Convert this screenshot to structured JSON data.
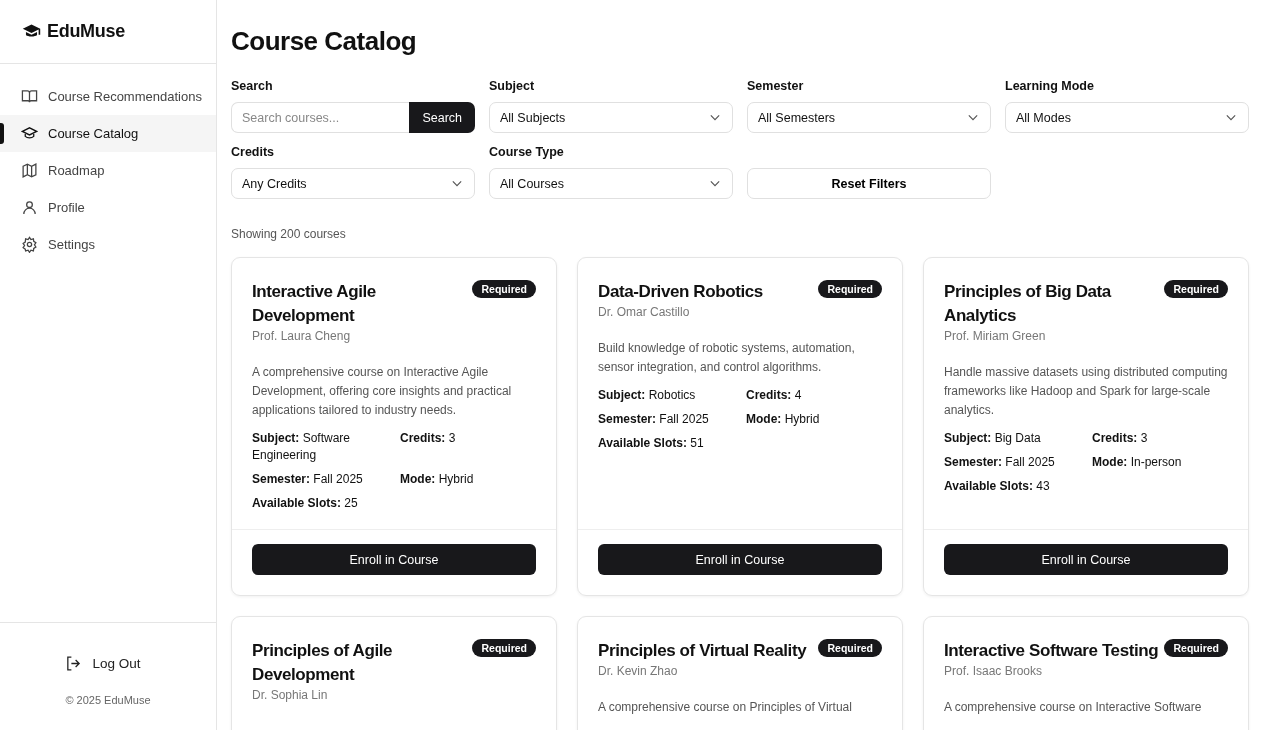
{
  "brand": {
    "name": "EduMuse"
  },
  "nav": [
    {
      "label": "Course Recommendations",
      "selected": false
    },
    {
      "label": "Course Catalog",
      "selected": true
    },
    {
      "label": "Roadmap",
      "selected": false
    },
    {
      "label": "Profile",
      "selected": false
    },
    {
      "label": "Settings",
      "selected": false
    }
  ],
  "logout": "Log Out",
  "copyright": "© 2025 EduMuse",
  "page_title": "Course Catalog",
  "filters": [
    {
      "kind": "search",
      "label": "Search",
      "placeholder": "Search courses...",
      "button": "Search"
    },
    {
      "kind": "select",
      "label": "Subject",
      "value": "All Subjects"
    },
    {
      "kind": "select",
      "label": "Semester",
      "value": "All Semesters"
    },
    {
      "kind": "select",
      "label": "Learning Mode",
      "value": "All Modes"
    },
    {
      "kind": "select",
      "label": "Credits",
      "value": "Any Credits"
    },
    {
      "kind": "select",
      "label": "Course Type",
      "value": "All Courses"
    },
    {
      "kind": "reset",
      "button": "Reset Filters"
    }
  ],
  "result_count": "Showing 200 courses",
  "courses": [
    {
      "title": "Interactive Agile Development",
      "badge": "Required",
      "instructor": "Prof. Laura Cheng",
      "description": "A comprehensive course on Interactive Agile Development, offering core insights and practical applications tailored to industry needs.",
      "details": [
        {
          "label": "Subject:",
          "value": "Software Engineering"
        },
        {
          "label": "Credits:",
          "value": "3"
        },
        {
          "label": "Semester:",
          "value": "Fall 2025"
        },
        {
          "label": "Mode:",
          "value": "Hybrid"
        },
        {
          "label": "Available Slots:",
          "value": "25"
        }
      ],
      "action": "Enroll in Course"
    },
    {
      "title": "Data-Driven Robotics",
      "badge": "Required",
      "instructor": "Dr. Omar Castillo",
      "description": "Build knowledge of robotic systems, automation, sensor integration, and control algorithms.",
      "details": [
        {
          "label": "Subject:",
          "value": "Robotics"
        },
        {
          "label": "Credits:",
          "value": "4"
        },
        {
          "label": "Semester:",
          "value": "Fall 2025"
        },
        {
          "label": "Mode:",
          "value": "Hybrid"
        },
        {
          "label": "Available Slots:",
          "value": "51"
        }
      ],
      "action": "Enroll in Course"
    },
    {
      "title": "Principles of Big Data Analytics",
      "badge": "Required",
      "instructor": "Prof. Miriam Green",
      "description": "Handle massive datasets using distributed computing frameworks like Hadoop and Spark for large-scale analytics.",
      "details": [
        {
          "label": "Subject:",
          "value": "Big Data"
        },
        {
          "label": "Credits:",
          "value": "3"
        },
        {
          "label": "Semester:",
          "value": "Fall 2025"
        },
        {
          "label": "Mode:",
          "value": "In-person"
        },
        {
          "label": "Available Slots:",
          "value": "43"
        }
      ],
      "action": "Enroll in Course"
    },
    {
      "title": "Principles of Agile Development",
      "badge": "Required",
      "instructor": "Dr. Sophia Lin"
    },
    {
      "title": "Principles of Virtual Reality",
      "badge": "Required",
      "instructor": "Dr. Kevin Zhao",
      "description": "A comprehensive course on Principles of Virtual"
    },
    {
      "title": "Interactive Software Testing",
      "badge": "Required",
      "instructor": "Prof. Isaac Brooks",
      "description": "A comprehensive course on Interactive Software"
    }
  ]
}
